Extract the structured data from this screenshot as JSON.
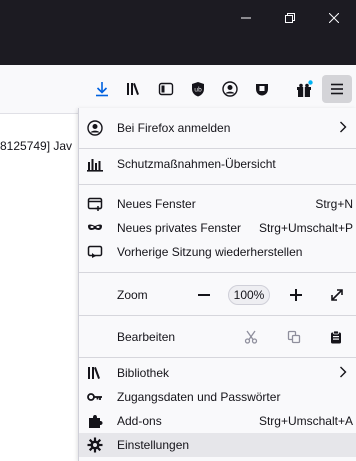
{
  "window": {
    "controls": [
      "minimize-icon",
      "restore-icon",
      "close-icon"
    ]
  },
  "toolbar": {
    "icons": [
      "downloads-icon",
      "library-icon",
      "sidebar-icon",
      "ublock-icon",
      "account-icon",
      "pocket-icon",
      "gift-icon",
      "menu-icon"
    ],
    "accent": "#0061e0"
  },
  "page": {
    "crumb": "8125749] Jav"
  },
  "menu": {
    "sign_in": "Bei Firefox anmelden",
    "protections": "Schutzmaßnahmen-Übersicht",
    "new_window": "Neues Fenster",
    "new_window_sc": "Strg+N",
    "private_window": "Neues privates Fenster",
    "private_window_sc": "Strg+Umschalt+P",
    "restore_session": "Vorherige Sitzung wiederherstellen",
    "zoom_label": "Zoom",
    "zoom_value": "100%",
    "edit_label": "Bearbeiten",
    "library": "Bibliothek",
    "logins": "Zugangsdaten und Passwörter",
    "addons": "Add-ons",
    "addons_sc": "Strg+Umschalt+A",
    "settings": "Einstellungen"
  }
}
